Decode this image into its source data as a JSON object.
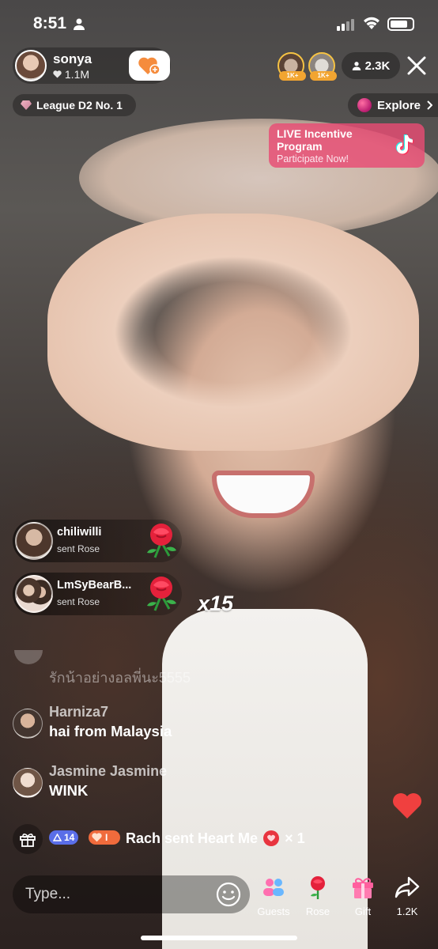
{
  "status_bar": {
    "time": "8:51"
  },
  "host": {
    "name": "sonya",
    "likes": "1.1M"
  },
  "top_viewers": [
    {
      "badge": "1K+"
    },
    {
      "badge": "1K+"
    }
  ],
  "viewers": {
    "count": "2.3K"
  },
  "league": {
    "label": "League D2 No. 1"
  },
  "explore": {
    "label": "Explore"
  },
  "incentive": {
    "title": "LIVE Incentive Program",
    "subtitle": "Participate Now!"
  },
  "gift_events": [
    {
      "user": "chiliwilli",
      "action": "sent Rose"
    },
    {
      "user": "LmSyBearB...",
      "action": "sent Rose",
      "multiplier": "x15"
    }
  ],
  "faded_comment": "รักน้าอย่างอลพี่นะ5555",
  "comments": [
    {
      "name": "Harniza7",
      "text": "hai from Malaysia"
    },
    {
      "name": "Jasmine Jasmine",
      "text": "WINK"
    }
  ],
  "ticker": {
    "badge_level": "14",
    "badge_heart": "I",
    "text": "Rach sent Heart Me",
    "count": "× 1"
  },
  "comment_input": {
    "placeholder": "Type..."
  },
  "toolbar": {
    "guests_label": "Guests",
    "rose_label": "Rose",
    "gift_label": "Gift",
    "share_count": "1.2K"
  },
  "colors": {
    "accent": "#fe2c55",
    "follow": "#f58c3d",
    "incentive": "#e84c74",
    "badge_blue": "#5a6ee8"
  }
}
